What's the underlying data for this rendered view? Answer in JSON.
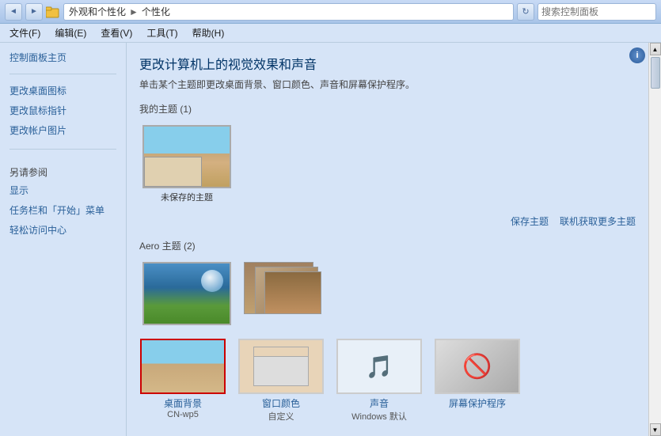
{
  "titlebar": {
    "back_btn": "◄",
    "forward_btn": "►",
    "path_parts": [
      "外观和个性化",
      "►",
      "个性化"
    ],
    "refresh_btn": "↻",
    "search_placeholder": "搜索控制面板"
  },
  "menubar": {
    "items": [
      "文件(F)",
      "编辑(E)",
      "查看(V)",
      "工具(T)",
      "帮助(H)"
    ]
  },
  "sidebar": {
    "home_link": "控制面板主页",
    "links": [
      "更改桌面图标",
      "更改鼠标指针",
      "更改帐户图片"
    ],
    "also_see_title": "另请参阅",
    "also_see_links": [
      "显示",
      "任务栏和「开始」菜单",
      "轻松访问中心"
    ]
  },
  "content": {
    "title": "更改计算机上的视觉效果和声音",
    "subtitle": "单击某个主题即更改桌面背景、窗口颜色、声音和屏幕保护程序。",
    "my_themes_label": "我的主题 (1)",
    "my_themes": [
      {
        "name": "未保存的主题",
        "active": false
      }
    ],
    "save_theme_link": "保存主题",
    "get_more_link": "联机获取更多主题",
    "aero_themes_label": "Aero 主题 (2)",
    "aero_themes": [
      {
        "name": ""
      },
      {
        "name": ""
      }
    ],
    "customization": {
      "items": [
        {
          "name": "桌面背景",
          "value": "CN-wp5",
          "selected": true
        },
        {
          "name": "窗口颜色",
          "value": "自定义",
          "selected": false
        },
        {
          "name": "声音",
          "value": "Windows 默认",
          "selected": false
        },
        {
          "name": "屏幕保护程序",
          "value": "",
          "selected": false
        }
      ]
    }
  }
}
